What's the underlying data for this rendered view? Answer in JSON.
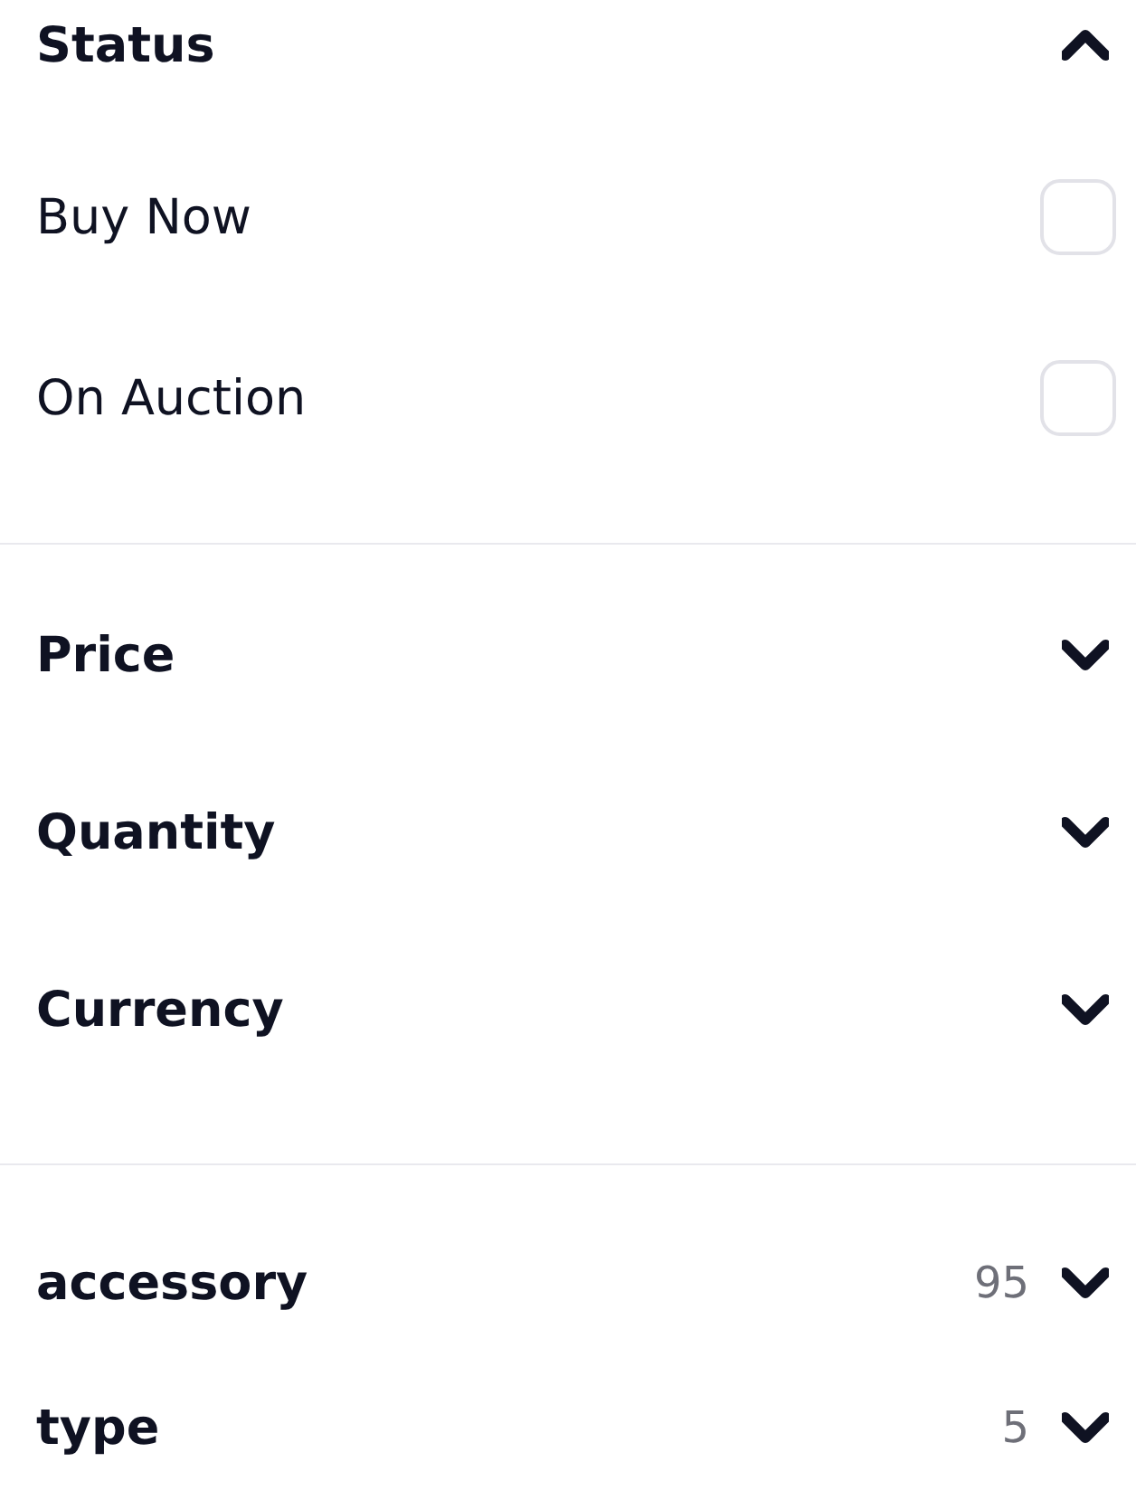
{
  "filter_groups": [
    {
      "filters": [
        {
          "kind": "section",
          "title": "Status",
          "expanded": true,
          "options": [
            {
              "label": "Buy Now",
              "checked": false
            },
            {
              "label": "On Auction",
              "checked": false
            }
          ]
        }
      ]
    },
    {
      "filters": [
        {
          "kind": "section",
          "title": "Price",
          "expanded": false
        },
        {
          "kind": "section",
          "title": "Quantity",
          "expanded": false
        },
        {
          "kind": "section",
          "title": "Currency",
          "expanded": false
        }
      ]
    },
    {
      "filters": [
        {
          "kind": "section",
          "title": "accessory",
          "count": "95",
          "expanded": false
        },
        {
          "kind": "section",
          "title": "type",
          "count": "5",
          "expanded": false
        }
      ]
    }
  ]
}
